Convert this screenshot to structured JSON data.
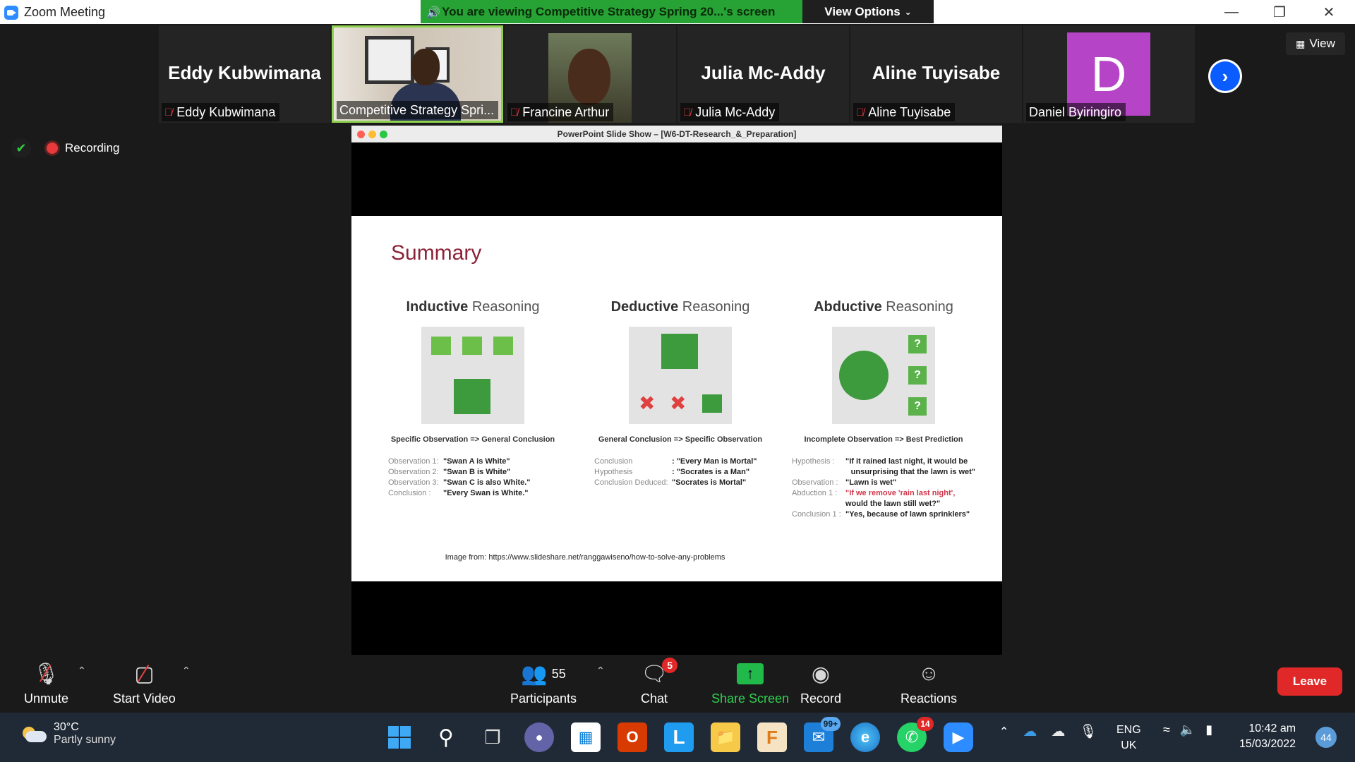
{
  "window": {
    "title": "Zoom Meeting"
  },
  "banner": {
    "text": "You are viewing Competitive Strategy Spring 20...'s screen",
    "view_options": "View Options"
  },
  "participants": [
    {
      "name": "Eddy Kubwimana",
      "big_name": "Eddy Kubwimana",
      "muted": true
    },
    {
      "name": "Competitive Strategy Spri...",
      "video": true
    },
    {
      "name": "Francine Arthur",
      "muted": true,
      "photo": true
    },
    {
      "name": "Julia Mc-Addy",
      "big_name": "Julia Mc-Addy",
      "muted": true
    },
    {
      "name": "Aline Tuyisabe",
      "big_name": "Aline Tuyisabe",
      "muted": true
    },
    {
      "name": "Daniel Byiringiro",
      "avatar_letter": "D"
    }
  ],
  "view_button": "View",
  "status": {
    "recording": "Recording"
  },
  "shared_window": {
    "title": "PowerPoint Slide Show – [W6-DT-Research_&_Preparation]"
  },
  "slide": {
    "title": "Summary",
    "columns": [
      {
        "heading_bold": "Inductive",
        "heading_rest": " Reasoning",
        "caption": "Specific Observation => General Conclusion",
        "rows": [
          {
            "k": "Observation 1:",
            "v": "\"Swan A is White\""
          },
          {
            "k": "Observation 2:",
            "v": "\"Swan B is White\""
          },
          {
            "k": "Observation 3:",
            "v": "\"Swan C is also White.\""
          },
          {
            "k": "Conclusion :",
            "v": "\"Every Swan is White.\""
          }
        ]
      },
      {
        "heading_bold": "Deductive",
        "heading_rest": " Reasoning",
        "caption": "General Conclusion => Specific Observation",
        "rows": [
          {
            "k": "Conclusion",
            "v": ": \"Every Man is Mortal\""
          },
          {
            "k": "Hypothesis",
            "v": ": \"Socrates is a Man\""
          },
          {
            "k": "Conclusion Deduced:",
            "v": " \"Socrates is Mortal\""
          }
        ]
      },
      {
        "heading_bold": "Abductive",
        "heading_rest": " Reasoning",
        "caption": "Incomplete Observation => Best Prediction",
        "rows": [
          {
            "k": "Hypothesis :",
            "v": "\"If it rained last night, it would be"
          },
          {
            "k": "",
            "v": "unsurprising that the lawn is wet\""
          },
          {
            "k": "Observation :",
            "v": "\"Lawn is wet\""
          },
          {
            "k": "Abduction 1 :",
            "v": "\"If we remove 'rain last night',",
            "red": true
          },
          {
            "k": "",
            "v": "would the lawn still wet?\""
          },
          {
            "k": "Conclusion 1 :",
            "v": "\"Yes, because of lawn sprinklers\""
          }
        ],
        "question_mark": "?"
      }
    ],
    "credit": "Image from: https://www.slideshare.net/ranggawiseno/how-to-solve-any-problems"
  },
  "controls": {
    "unmute": "Unmute",
    "start_video": "Start Video",
    "participants": "Participants",
    "participants_count": "55",
    "chat": "Chat",
    "chat_badge": "5",
    "share_screen": "Share Screen",
    "record": "Record",
    "reactions": "Reactions",
    "leave": "Leave"
  },
  "taskbar": {
    "weather_temp": "30°C",
    "weather_desc": "Partly sunny",
    "mail_badge": "99+",
    "whatsapp_badge": "14",
    "lang1": "ENG",
    "lang2": "UK",
    "time": "10:42 am",
    "date": "15/03/2022",
    "notifications": "44"
  },
  "colors": {
    "banner_green": "#26a334",
    "leave_red": "#e02828",
    "accent_blue": "#0b5cff",
    "slide_title": "#8b2339"
  },
  "icons": [
    "zoom-logo-icon",
    "speaker-icon",
    "chevron-down-icon",
    "microphone-muted-icon",
    "shield-check-icon",
    "record-icon",
    "chevron-right-icon",
    "grid-icon",
    "video-off-icon",
    "participants-icon",
    "chat-icon",
    "share-screen-icon",
    "reactions-icon"
  ]
}
